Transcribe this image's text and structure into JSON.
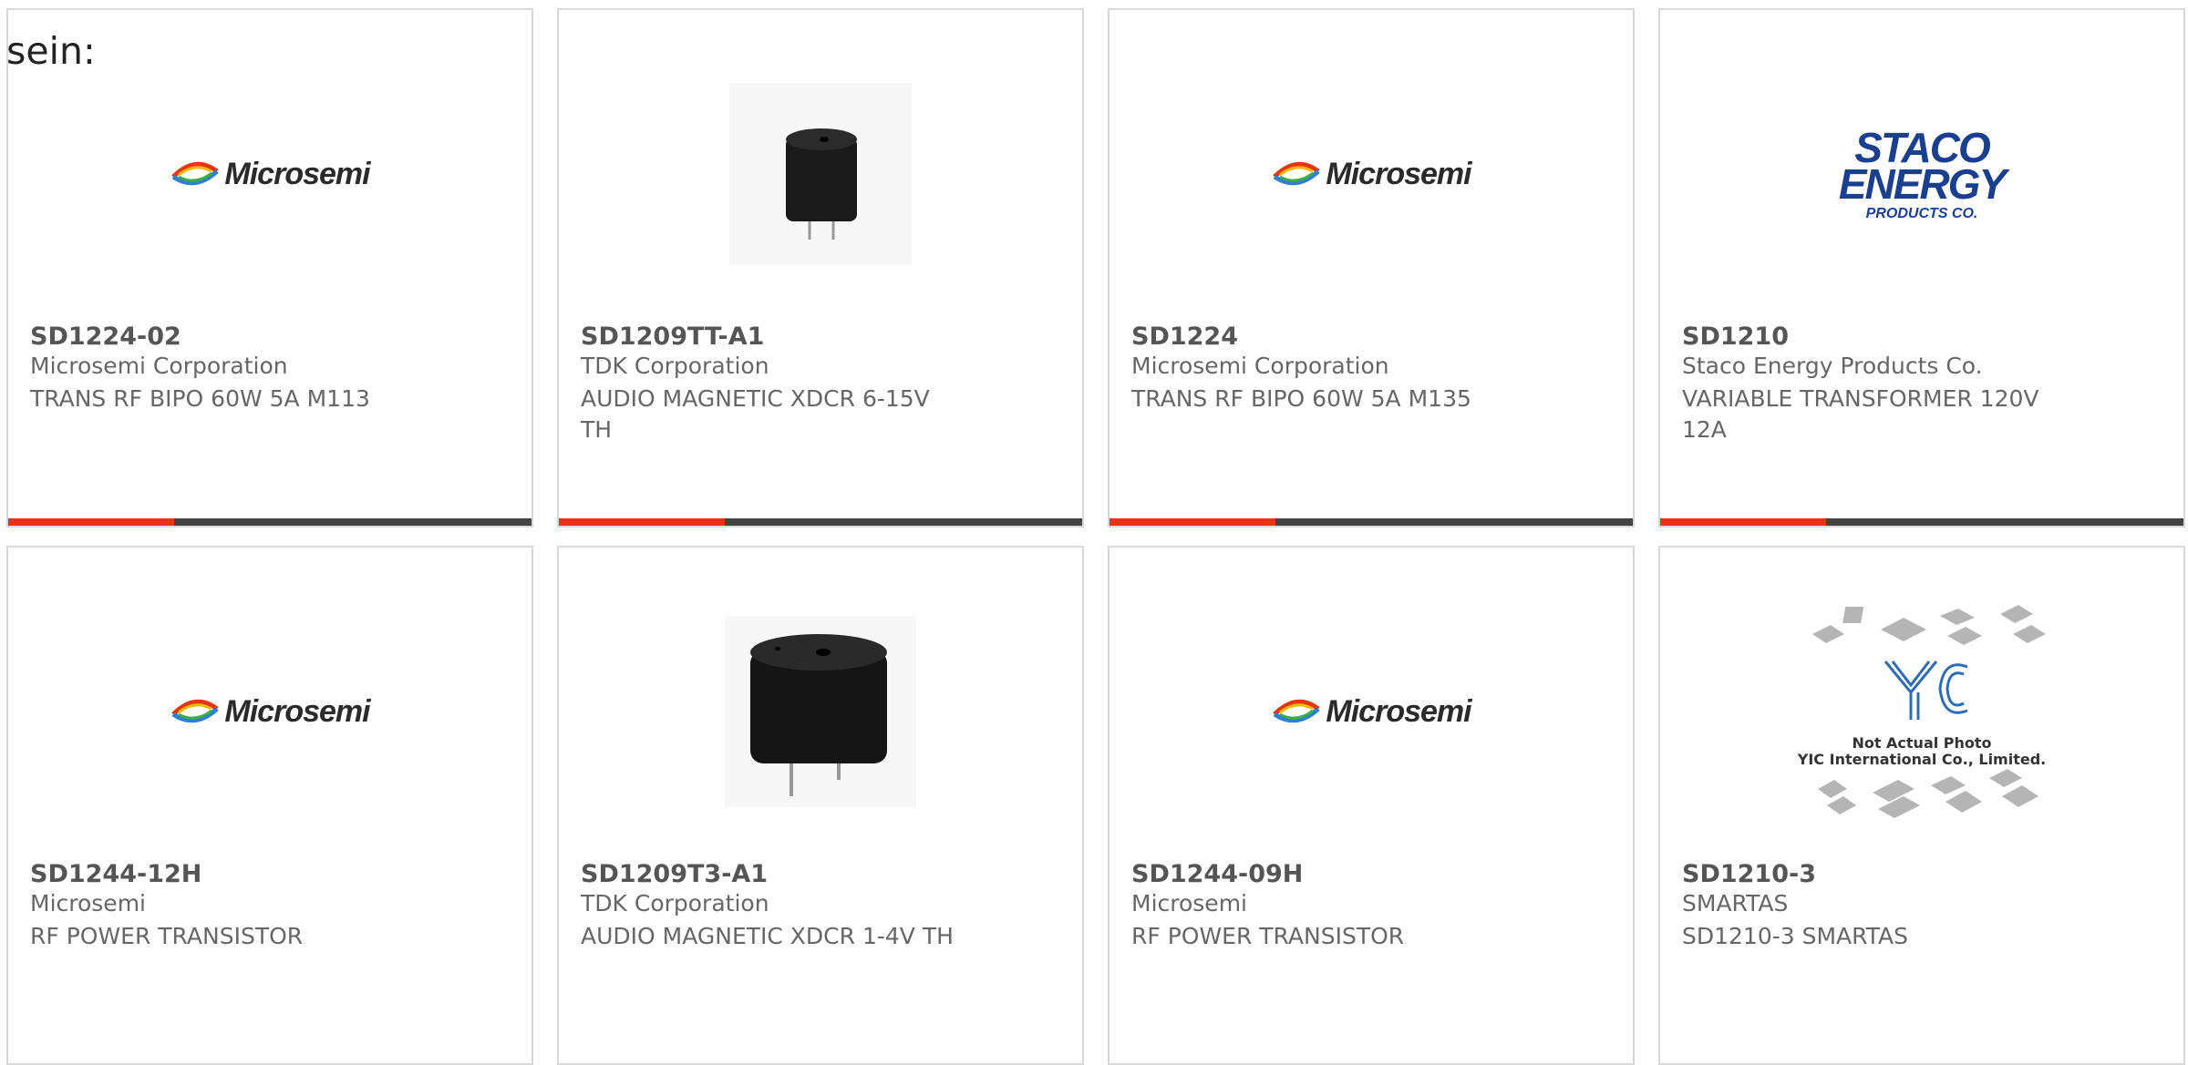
{
  "page": {
    "lead_text": "sein:"
  },
  "cards": [
    {
      "part": "SD1224-02",
      "manufacturer": "Microsemi Corporation",
      "description": "TRANS RF BIPO 60W 5A M113",
      "image": "microsemi-logo"
    },
    {
      "part": "SD1209TT-A1",
      "manufacturer": "TDK Corporation",
      "description": "AUDIO MAGNETIC XDCR 6-15V TH",
      "image": "buzzer-photo"
    },
    {
      "part": "SD1224",
      "manufacturer": "Microsemi Corporation",
      "description": "TRANS RF BIPO 60W 5A M135",
      "image": "microsemi-logo"
    },
    {
      "part": "SD1210",
      "manufacturer": "Staco Energy Products Co.",
      "description": "VARIABLE TRANSFORMER 120V 12A",
      "image": "staco-logo"
    },
    {
      "part": "SD1244-12H",
      "manufacturer": "Microsemi",
      "description": "RF POWER TRANSISTOR",
      "image": "microsemi-logo"
    },
    {
      "part": "SD1209T3-A1",
      "manufacturer": "TDK Corporation",
      "description": "AUDIO MAGNETIC XDCR 1-4V TH",
      "image": "buzzer-photo"
    },
    {
      "part": "SD1244-09H",
      "manufacturer": "Microsemi",
      "description": "RF POWER TRANSISTOR",
      "image": "microsemi-logo"
    },
    {
      "part": "SD1210-3",
      "manufacturer": "SMARTAS",
      "description": "SD1210-3 SMARTAS",
      "image": "yic-placeholder"
    }
  ],
  "logos": {
    "microsemi": "Microsemi",
    "staco_line1": "STACO",
    "staco_line2": "ENERGY",
    "staco_line3": "PRODUCTS CO.",
    "yic_mark": "YIC",
    "yic_line1": "Not Actual Photo",
    "yic_line2": "YIC International Co., Limited."
  },
  "colors": {
    "accent": "#e8340f",
    "bar": "#424242",
    "border": "#d9d9d9",
    "text": "#666666",
    "title": "#555555"
  }
}
